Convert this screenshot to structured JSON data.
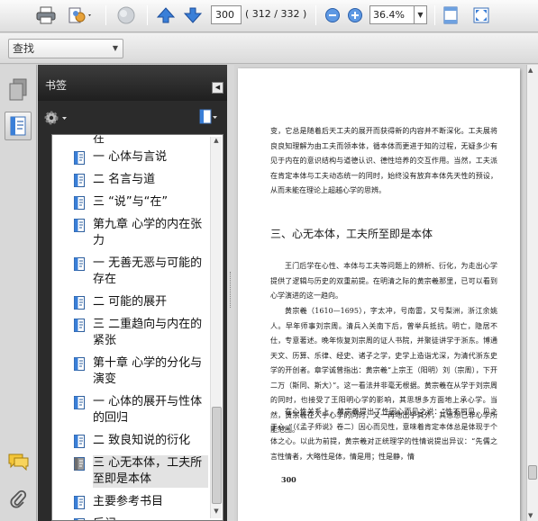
{
  "toolbar": {
    "page_current": "300",
    "page_count": "( 312 / 332 )",
    "zoom": "36.4%",
    "icons": [
      "printer-icon",
      "attach-icon",
      "cloud-icon",
      "prev-page-icon",
      "next-page-icon",
      "zoom-out-icon",
      "zoom-in-icon",
      "fit-page-icon",
      "full-screen-icon"
    ]
  },
  "find": {
    "label": "查找"
  },
  "panel": {
    "title": "书签",
    "items": [
      {
        "text": "在",
        "partial": true
      },
      {
        "text": "一 心体与言说"
      },
      {
        "text": "二 名言与道"
      },
      {
        "text": "三 “说”与“在”"
      },
      {
        "text": "第九章 心学的内在张力"
      },
      {
        "text": "一 无善无恶与可能的存在"
      },
      {
        "text": "二 可能的展开"
      },
      {
        "text": "三 二重趋向与内在的紧张"
      },
      {
        "text": "第十章 心学的分化与演变"
      },
      {
        "text": "一 心体的展开与性体的回归"
      },
      {
        "text": "二 致良知说的衍化"
      },
      {
        "text": "三 心无本体，工夫所至即是本体",
        "selected": true
      },
      {
        "text": "主要参考书目"
      },
      {
        "text": "后记"
      }
    ]
  },
  "document": {
    "para1": "变，它总是随着后天工夫的展开而获得新的内容并不断深化。工夫展将良良知理解为由工夫而领本体，循本体而更进于知的过程，无疑多少有见于内在的意识结构与道德认识、德性培养的交互作用。当然，工夫派在肯定本体与工夫动态统一的同时，始终没有放弃本体先天性的预设，从而未能在理论上超越心学的思辨。",
    "heading": "三、心无本体，工夫所至即是本体",
    "para2": "王门后学在心性、本体与工夫等问题上的辨析、衍化，为走出心学提供了逻辑与历史的双重前提。在明清之际的黄宗羲那里，已可以看到心学演进的这一趋向。",
    "para3": "黄宗羲（1610—1695），字太冲，号南雷，又号梨洲，浙江余姚人。早年师事刘宗周。清兵入关南下后，曾举兵抵抗。明亡，隐居不仕，专意著述。晚年恢复刘宗周的证人书院，并聚徒讲学于浙东。博通天文、历算、乐律、经史、诸子之学，史学上造诣尤深，为清代浙东史学的开创者。章学诚曾指出：黄宗羲“上宗王（阳明）刘（宗周），下开二万（斯同、斯大）”。这一看法并非毫无根据。黄宗羲在从学于刘宗周的同时，也接受了王阳明心学的影响，其思想多方面地上承心学。当然，黄宗羲在入乎心学的同时，又一再地出乎其外，其思想已非心学所能范围。",
    "para4": "在心性关系上，黄宗羲提出了性因心而见之说：“性不可见，见之于心。”（《孟子师说》卷二）因心而见性，意味着肯定本体总是体现于个体之心。以此为前提，黄宗羲对正统理学的性情说提出异议：“先儒之言性情者，大略性是体，情是用；性是静，情",
    "page_number": "300"
  }
}
